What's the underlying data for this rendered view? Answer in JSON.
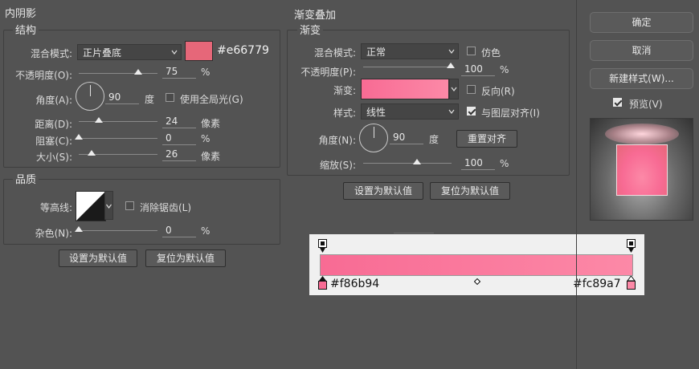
{
  "inner_shadow": {
    "title": "内阴影",
    "structure": {
      "title": "结构",
      "blend_mode_label": "混合模式:",
      "blend_mode_value": "正片叠底",
      "color_hex": "#e66779",
      "color": "#e66779",
      "opacity_label": "不透明度(O):",
      "opacity_value": "75",
      "opacity_unit": "%",
      "opacity_fraction": 0.75,
      "angle_label": "角度(A):",
      "angle_value": "90",
      "angle_unit": "度",
      "global_light_label": "使用全局光(G)",
      "global_light_checked": false,
      "distance_label": "距离(D):",
      "distance_value": "24",
      "distance_unit": "像素",
      "choke_label": "阻塞(C):",
      "choke_value": "0",
      "choke_unit": "%",
      "size_label": "大小(S):",
      "size_value": "26",
      "size_unit": "像素"
    },
    "quality": {
      "title": "品质",
      "contour_label": "等高线:",
      "antialias_label": "消除锯齿(L)",
      "antialias_checked": false,
      "noise_label": "杂色(N):",
      "noise_value": "0",
      "noise_unit": "%"
    },
    "set_default_label": "设置为默认值",
    "reset_default_label": "复位为默认值"
  },
  "gradient_overlay": {
    "title": "渐变叠加",
    "group_title": "渐变",
    "blend_mode_label": "混合模式:",
    "blend_mode_value": "正常",
    "dither_label": "仿色",
    "dither_checked": false,
    "opacity_label": "不透明度(P):",
    "opacity_value": "100",
    "opacity_unit": "%",
    "gradient_label": "渐变:",
    "reverse_label": "反向(R)",
    "reverse_checked": false,
    "style_label": "样式:",
    "style_value": "线性",
    "align_layer_label": "与图层对齐(I)",
    "align_layer_checked": true,
    "angle_label": "角度(N):",
    "angle_value": "90",
    "angle_unit": "度",
    "reset_align_label": "重置对齐",
    "scale_label": "缩放(S):",
    "scale_value": "100",
    "scale_unit": "%",
    "set_default_label": "设置为默认值",
    "reset_default_label": "复位为默认值"
  },
  "gradient_editor": {
    "start_hex": "#f86b94",
    "end_hex": "#fc89a7",
    "start_color": "#f86b94",
    "end_color": "#fc89a7"
  },
  "side_panel": {
    "ok_label": "确定",
    "cancel_label": "取消",
    "new_style_label": "新建样式(W)...",
    "preview_label": "预览(V)",
    "preview_checked": true
  }
}
